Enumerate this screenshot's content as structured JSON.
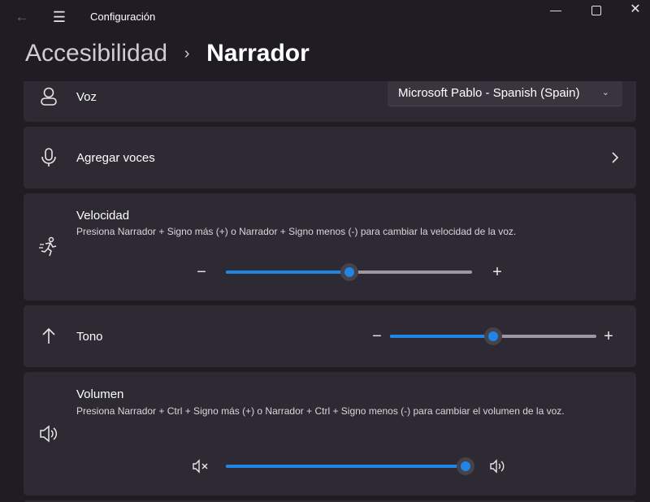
{
  "window": {
    "title": "Configuración",
    "back_icon": "back-arrow-icon",
    "menu_icon": "hamburger-menu-icon"
  },
  "breadcrumb": {
    "parent": "Accesibilidad",
    "separator": "›",
    "current": "Narrador"
  },
  "voice": {
    "label": "Voz",
    "icon": "person-icon",
    "dropdown_value": "Microsoft Pablo - Spanish (Spain)"
  },
  "add_voices": {
    "label": "Agregar voces",
    "icon": "microphone-icon"
  },
  "speed": {
    "label": "Velocidad",
    "description": "Presiona Narrador + Signo más (+) o Narrador + Signo menos (-) para cambiar la velocidad de la voz.",
    "icon": "runner-icon",
    "minus": "−",
    "plus": "+",
    "value_fraction": 0.5
  },
  "pitch": {
    "label": "Tono",
    "icon": "up-arrow-icon",
    "minus": "−",
    "plus": "+",
    "value_fraction": 0.5
  },
  "volume": {
    "label": "Volumen",
    "description": "Presiona Narrador + Ctrl + Signo más (+) o Narrador + Ctrl + Signo menos (-) para cambiar el volumen de la voz.",
    "icon": "speaker-icon",
    "value_fraction": 1.0
  },
  "colors": {
    "accent": "#1f86e6",
    "card": "#2d2a33",
    "background": "#1f1c23"
  }
}
